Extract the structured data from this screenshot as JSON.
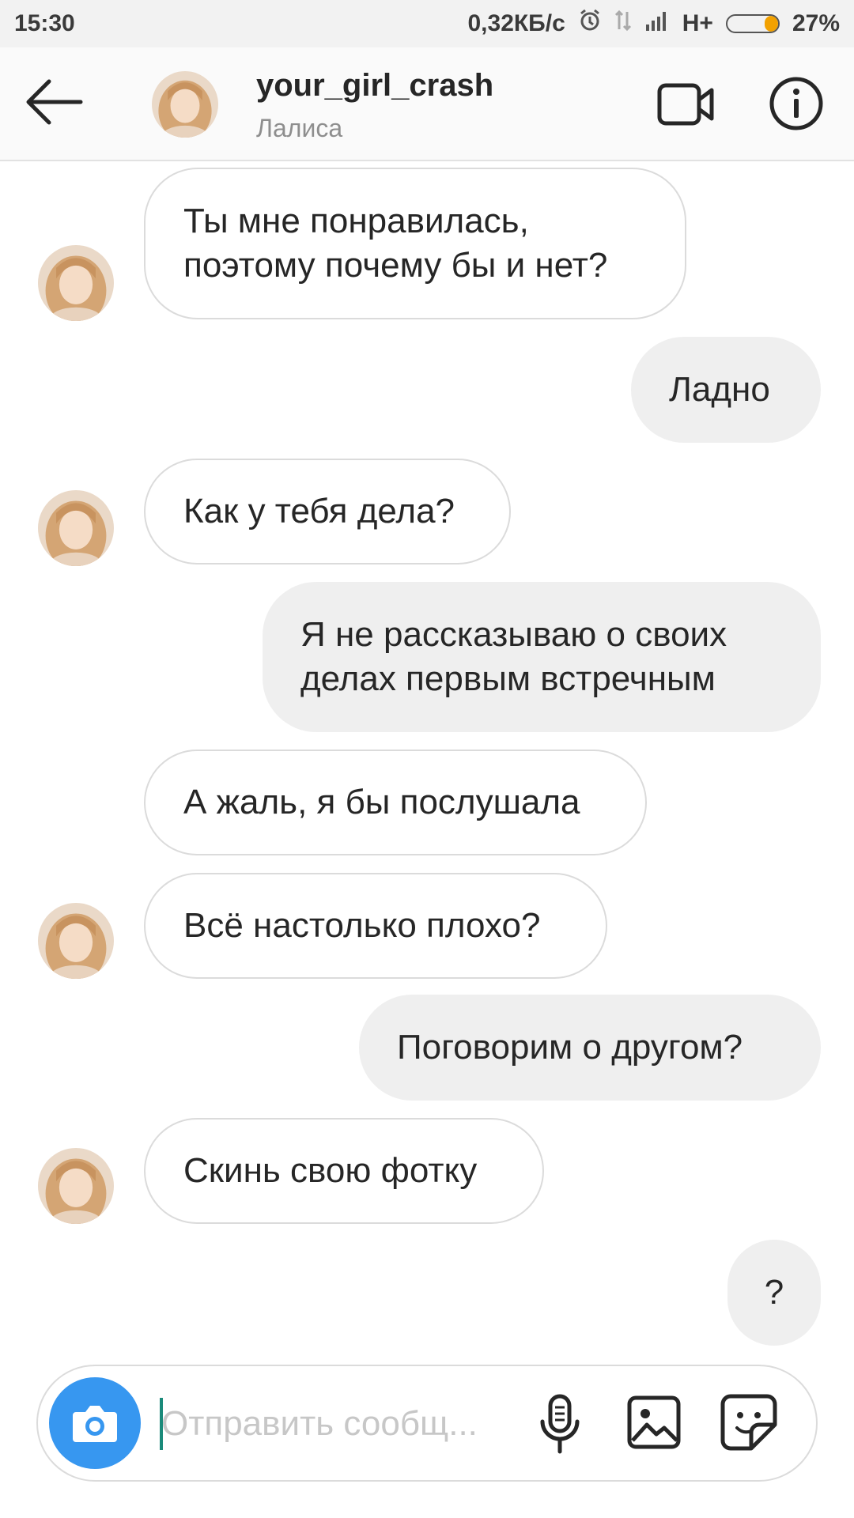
{
  "status_bar": {
    "time": "15:30",
    "network_speed": "0,32КБ/с",
    "network_type": "H+",
    "battery_percent": "27%",
    "battery_level": 0.27,
    "icons": [
      "alarm-icon",
      "data-transfer-icon",
      "signal-icon",
      "battery-icon"
    ]
  },
  "header": {
    "back_icon": "arrow-left-icon",
    "username": "your_girl_crash",
    "real_name": "Лалиса",
    "video_icon": "video-camera-icon",
    "info_icon": "info-icon"
  },
  "messages": [
    {
      "direction": "incoming",
      "text": "Ты мне понравилась,\nпоэтому почему бы и нет?",
      "avatar": true
    },
    {
      "direction": "outgoing",
      "text": "Ладно"
    },
    {
      "direction": "incoming",
      "text": "Как у тебя дела?",
      "avatar": true
    },
    {
      "direction": "outgoing",
      "text": "Я не рассказываю о своих\nделах первым встречным"
    },
    {
      "direction": "incoming",
      "text": "А жаль, я бы послушала",
      "avatar": false
    },
    {
      "direction": "incoming",
      "text": "Всё настолько плохо?",
      "avatar": true
    },
    {
      "direction": "outgoing",
      "text": "Поговорим о другом?"
    },
    {
      "direction": "incoming",
      "text": "Скинь свою фотку",
      "avatar": true
    },
    {
      "direction": "outgoing",
      "text": "?"
    }
  ],
  "composer": {
    "placeholder": "Отправить сообщ...",
    "value": "",
    "camera_icon": "camera-icon",
    "mic_icon": "microphone-icon",
    "gallery_icon": "gallery-icon",
    "sticker_icon": "sticker-icon"
  },
  "colors": {
    "accent": "#3797f0",
    "outgoing_bubble": "#efefef",
    "incoming_border": "#dbdbdb",
    "battery_fill": "#f2a100"
  }
}
